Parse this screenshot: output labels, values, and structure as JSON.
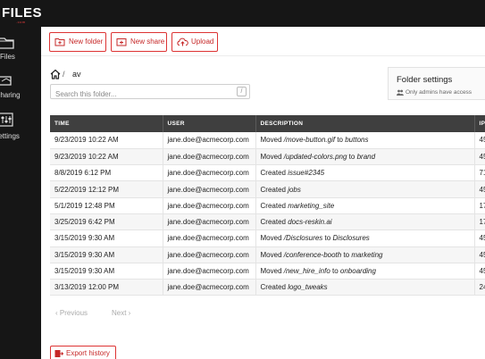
{
  "brand": {
    "name": "FILES",
    "suffix": ".com",
    "accent": "#e23b3b"
  },
  "sidebar": {
    "items": [
      {
        "label": "Files",
        "icon": "folder-icon"
      },
      {
        "label": "Sharing",
        "icon": "share-icon"
      },
      {
        "label": "Settings",
        "icon": "settings-sliders-icon"
      }
    ]
  },
  "toolbar": {
    "new_folder": "New folder",
    "new_share": "New share",
    "upload": "Upload"
  },
  "breadcrumb": {
    "separator": "/",
    "current": "av"
  },
  "search": {
    "placeholder": "Search this folder...",
    "shortcut": "/"
  },
  "folder_settings": {
    "title": "Folder settings",
    "subtitle": "Only admins have access"
  },
  "table": {
    "columns": [
      "TIME",
      "USER",
      "DESCRIPTION",
      "IP"
    ],
    "rows": [
      {
        "time": "9/23/2019 10:22 AM",
        "user": "jane.doe@acmecorp.com",
        "action": "Moved ",
        "item": "/move-button.gif",
        "mid": " to ",
        "target": "buttons",
        "ip": "45"
      },
      {
        "time": "9/23/2019 10:22 AM",
        "user": "jane.doe@acmecorp.com",
        "action": "Moved ",
        "item": "/updated-colors.png",
        "mid": " to ",
        "target": "brand",
        "ip": "45"
      },
      {
        "time": "8/8/2019 6:12 PM",
        "user": "jane.doe@acmecorp.com",
        "action": "Created ",
        "item": "issue#2345",
        "mid": "",
        "target": "",
        "ip": "71"
      },
      {
        "time": "5/22/2019 12:12 PM",
        "user": "jane.doe@acmecorp.com",
        "action": "Created ",
        "item": "jobs",
        "mid": "",
        "target": "",
        "ip": "45"
      },
      {
        "time": "5/1/2019 12:48 PM",
        "user": "jane.doe@acmecorp.com",
        "action": "Created ",
        "item": "marketing_site",
        "mid": "",
        "target": "",
        "ip": "17"
      },
      {
        "time": "3/25/2019 6:42 PM",
        "user": "jane.doe@acmecorp.com",
        "action": "Created ",
        "item": "docs-reskin.ai",
        "mid": "",
        "target": "",
        "ip": "17"
      },
      {
        "time": "3/15/2019 9:30 AM",
        "user": "jane.doe@acmecorp.com",
        "action": "Moved ",
        "item": "/Disclosures",
        "mid": " to ",
        "target": "Disclosures",
        "ip": "45"
      },
      {
        "time": "3/15/2019 9:30 AM",
        "user": "jane.doe@acmecorp.com",
        "action": "Moved ",
        "item": "/conference-booth",
        "mid": " to ",
        "target": "marketing",
        "ip": "45"
      },
      {
        "time": "3/15/2019 9:30 AM",
        "user": "jane.doe@acmecorp.com",
        "action": "Moved ",
        "item": "/new_hire_info",
        "mid": " to ",
        "target": "onboarding",
        "ip": "45"
      },
      {
        "time": "3/13/2019 12:00 PM",
        "user": "jane.doe@acmecorp.com",
        "action": "Created ",
        "item": "logo_tweaks",
        "mid": "",
        "target": "",
        "ip": "24"
      }
    ]
  },
  "pagination": {
    "previous": "Previous",
    "next": "Next"
  },
  "export": {
    "label": "Export history"
  }
}
